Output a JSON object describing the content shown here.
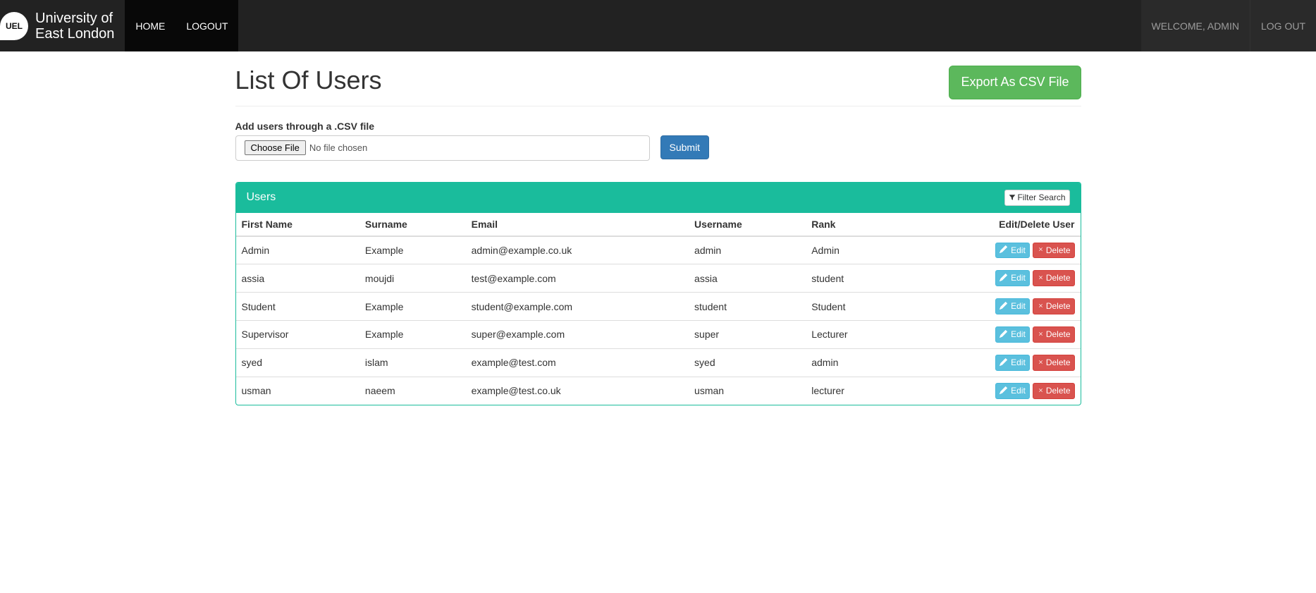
{
  "brand": {
    "badge": "UEL",
    "line1": "University of",
    "line2": "East London"
  },
  "nav": {
    "home": "HOME",
    "logout": "LOGOUT",
    "welcome": "WELCOME, ADMIN",
    "logout_right": "LOG OUT"
  },
  "page": {
    "title": "List Of Users",
    "export_btn": "Export As CSV File",
    "upload_label": "Add users through a .CSV file",
    "choose_file": "Choose File",
    "no_file": "No file chosen",
    "submit": "Submit"
  },
  "panel": {
    "title": "Users",
    "filter_btn": "Filter Search"
  },
  "table": {
    "headers": {
      "first_name": "First Name",
      "surname": "Surname",
      "email": "Email",
      "username": "Username",
      "rank": "Rank",
      "actions": "Edit/Delete User"
    },
    "rows": [
      {
        "first_name": "Admin",
        "surname": "Example",
        "email": "admin@example.co.uk",
        "username": "admin",
        "rank": "Admin"
      },
      {
        "first_name": "assia",
        "surname": "moujdi",
        "email": "test@example.com",
        "username": "assia",
        "rank": "student"
      },
      {
        "first_name": "Student",
        "surname": "Example",
        "email": "student@example.com",
        "username": "student",
        "rank": "Student"
      },
      {
        "first_name": "Supervisor",
        "surname": "Example",
        "email": "super@example.com",
        "username": "super",
        "rank": "Lecturer"
      },
      {
        "first_name": "syed",
        "surname": "islam",
        "email": "example@test.com",
        "username": "syed",
        "rank": "admin"
      },
      {
        "first_name": "usman",
        "surname": "naeem",
        "email": "example@test.co.uk",
        "username": "usman",
        "rank": "lecturer"
      }
    ]
  },
  "actions": {
    "edit": "Edit",
    "delete": "Delete"
  }
}
